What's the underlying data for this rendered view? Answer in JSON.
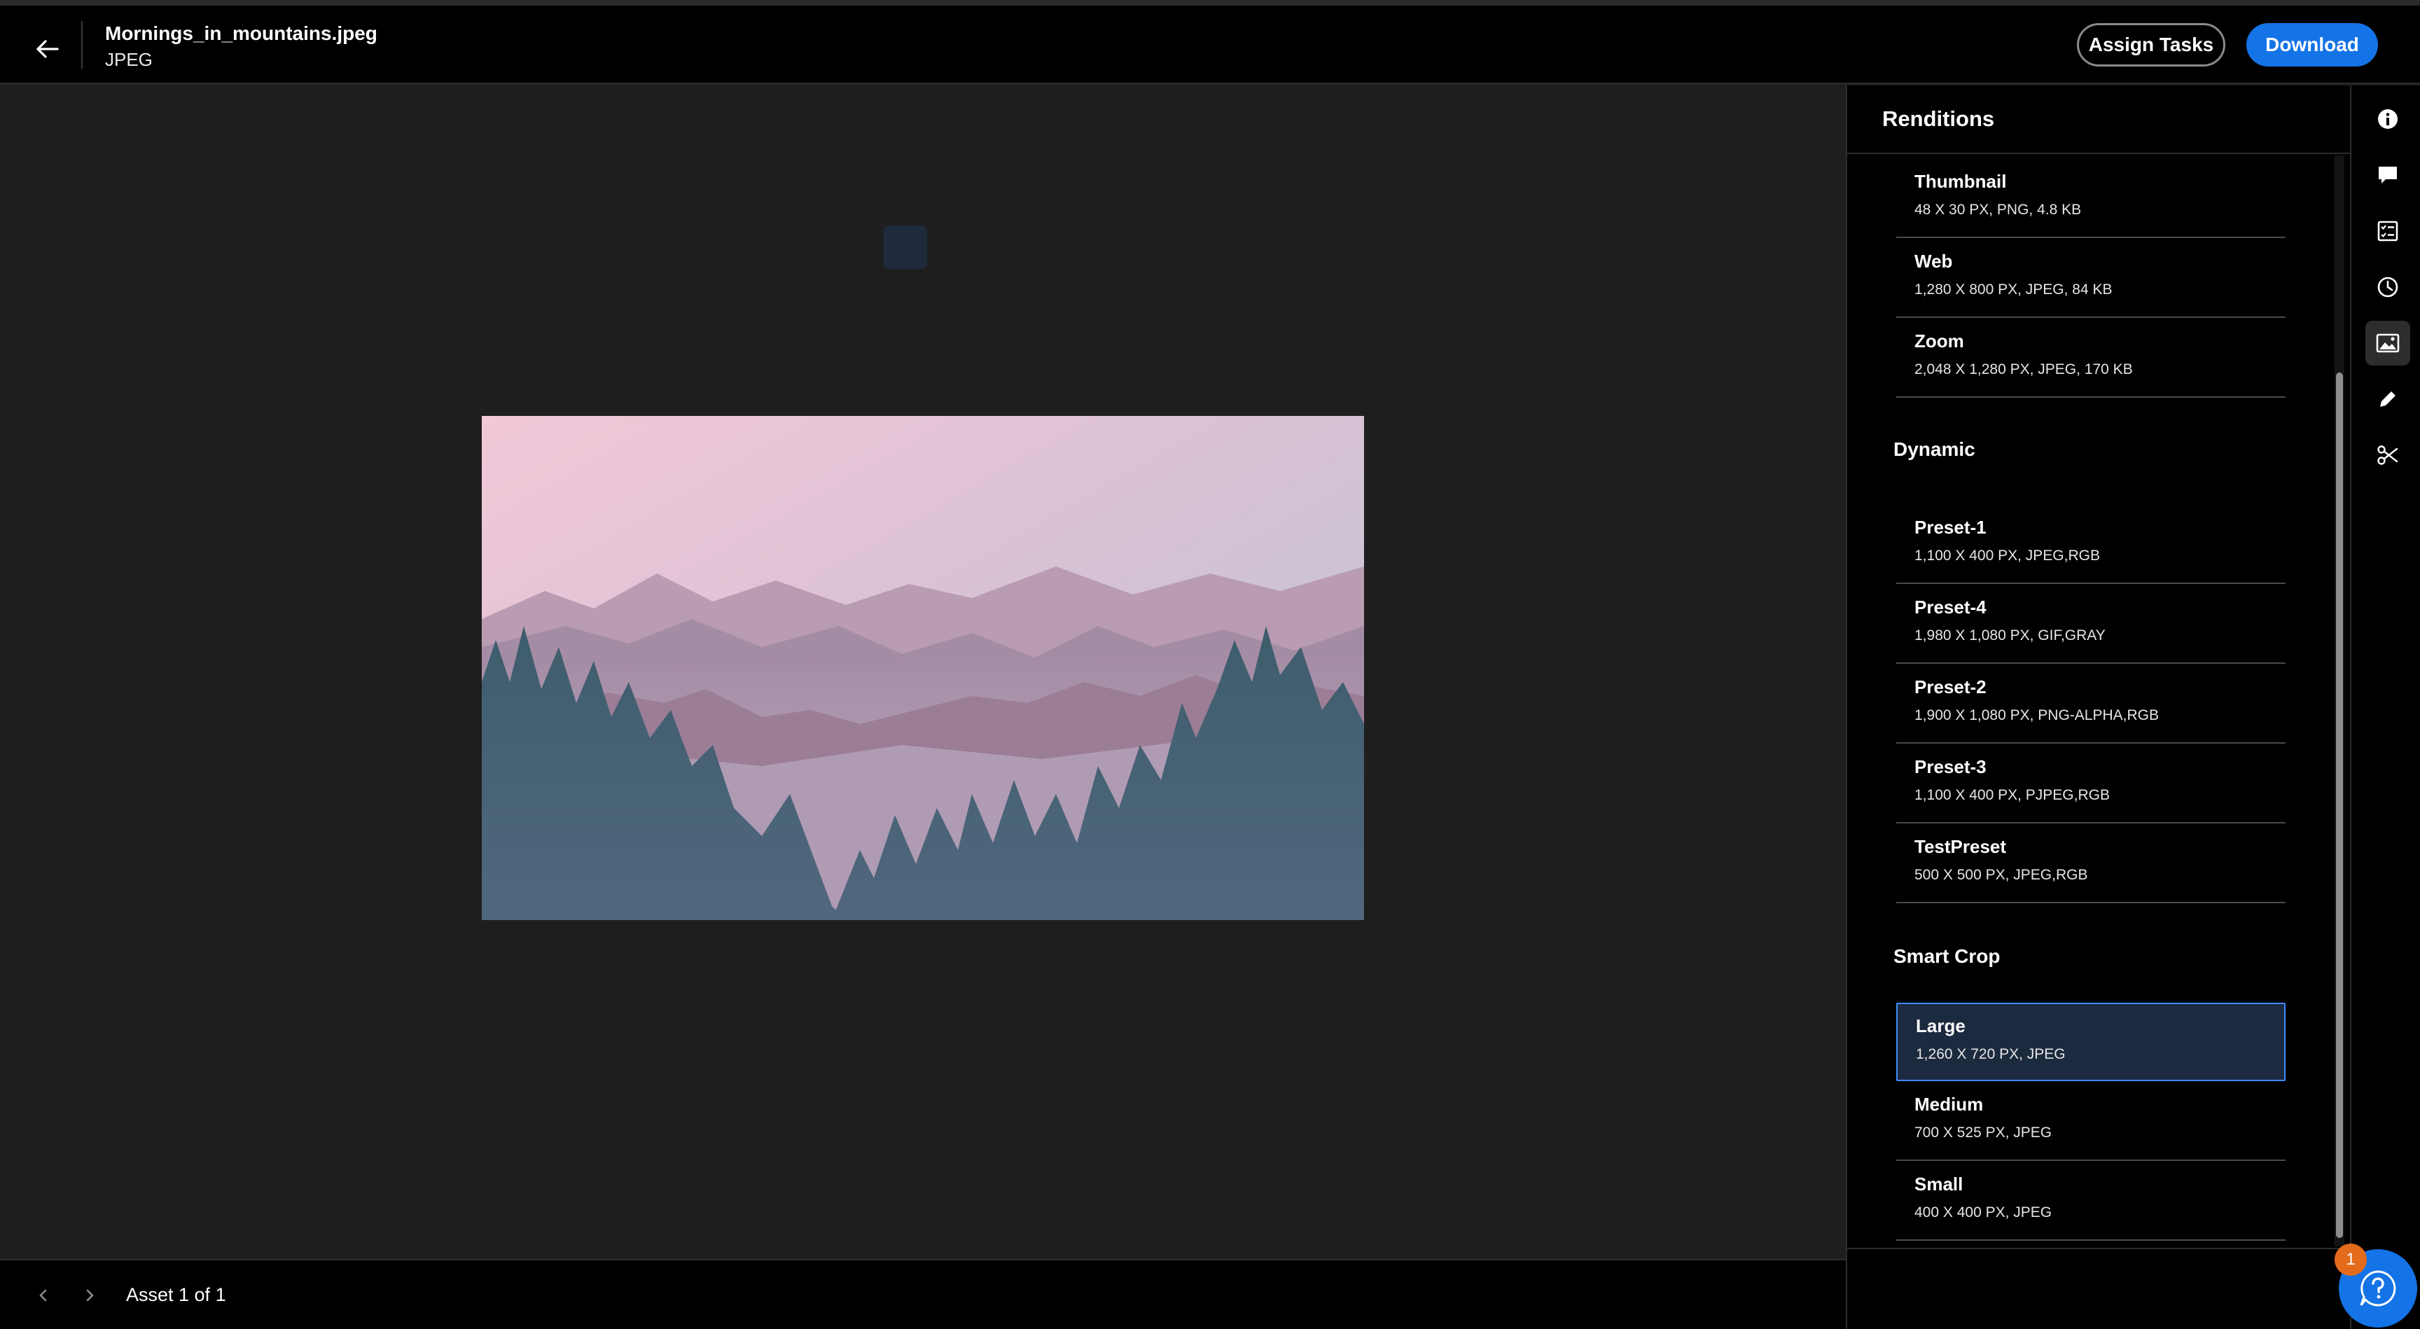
{
  "header": {
    "file_name": "Mornings_in_mountains.jpeg",
    "file_type": "JPEG",
    "assign_tasks_label": "Assign Tasks",
    "download_label": "Download"
  },
  "footer": {
    "asset_count": "Asset 1 of 1"
  },
  "panel": {
    "title": "Renditions",
    "sections": [
      {
        "heading": "",
        "items": [
          {
            "name": "Thumbnail",
            "meta": "48 X 30 PX, PNG, 4.8 KB"
          },
          {
            "name": "Web",
            "meta": "1,280 X 800 PX, JPEG, 84 KB"
          },
          {
            "name": "Zoom",
            "meta": "2,048 X 1,280 PX, JPEG, 170 KB"
          }
        ]
      },
      {
        "heading": "Dynamic",
        "items": [
          {
            "name": "Preset-1",
            "meta": "1,100 X 400 PX, JPEG,RGB"
          },
          {
            "name": "Preset-4",
            "meta": "1,980 X 1,080 PX, GIF,GRAY"
          },
          {
            "name": "Preset-2",
            "meta": "1,900 X 1,080 PX, PNG-ALPHA,RGB"
          },
          {
            "name": "Preset-3",
            "meta": "1,100 X 400 PX, PJPEG,RGB"
          },
          {
            "name": "TestPreset",
            "meta": "500 X 500 PX, JPEG,RGB"
          }
        ]
      },
      {
        "heading": "Smart Crop",
        "items": [
          {
            "name": "Large",
            "meta": "1,260 X 720 PX, JPEG",
            "selected": true
          },
          {
            "name": "Medium",
            "meta": "700 X 525 PX, JPEG"
          },
          {
            "name": "Small",
            "meta": "400 X 400 PX, JPEG"
          }
        ]
      }
    ]
  },
  "rail": {
    "items": [
      {
        "icon": "info-icon",
        "active": false
      },
      {
        "icon": "comment-icon",
        "active": false
      },
      {
        "icon": "tasks-icon",
        "active": false
      },
      {
        "icon": "history-icon",
        "active": false
      },
      {
        "icon": "renditions-icon",
        "active": true
      },
      {
        "icon": "edit-icon",
        "active": false
      },
      {
        "icon": "crop-icon",
        "active": false
      }
    ]
  },
  "help": {
    "badge_count": "1"
  },
  "colors": {
    "accent": "#1473e6",
    "selected_bg": "#1c2a3f",
    "selected_border": "#3f8cff",
    "badge": "#e36b1b",
    "viewer_bg": "#1e1e1e"
  }
}
